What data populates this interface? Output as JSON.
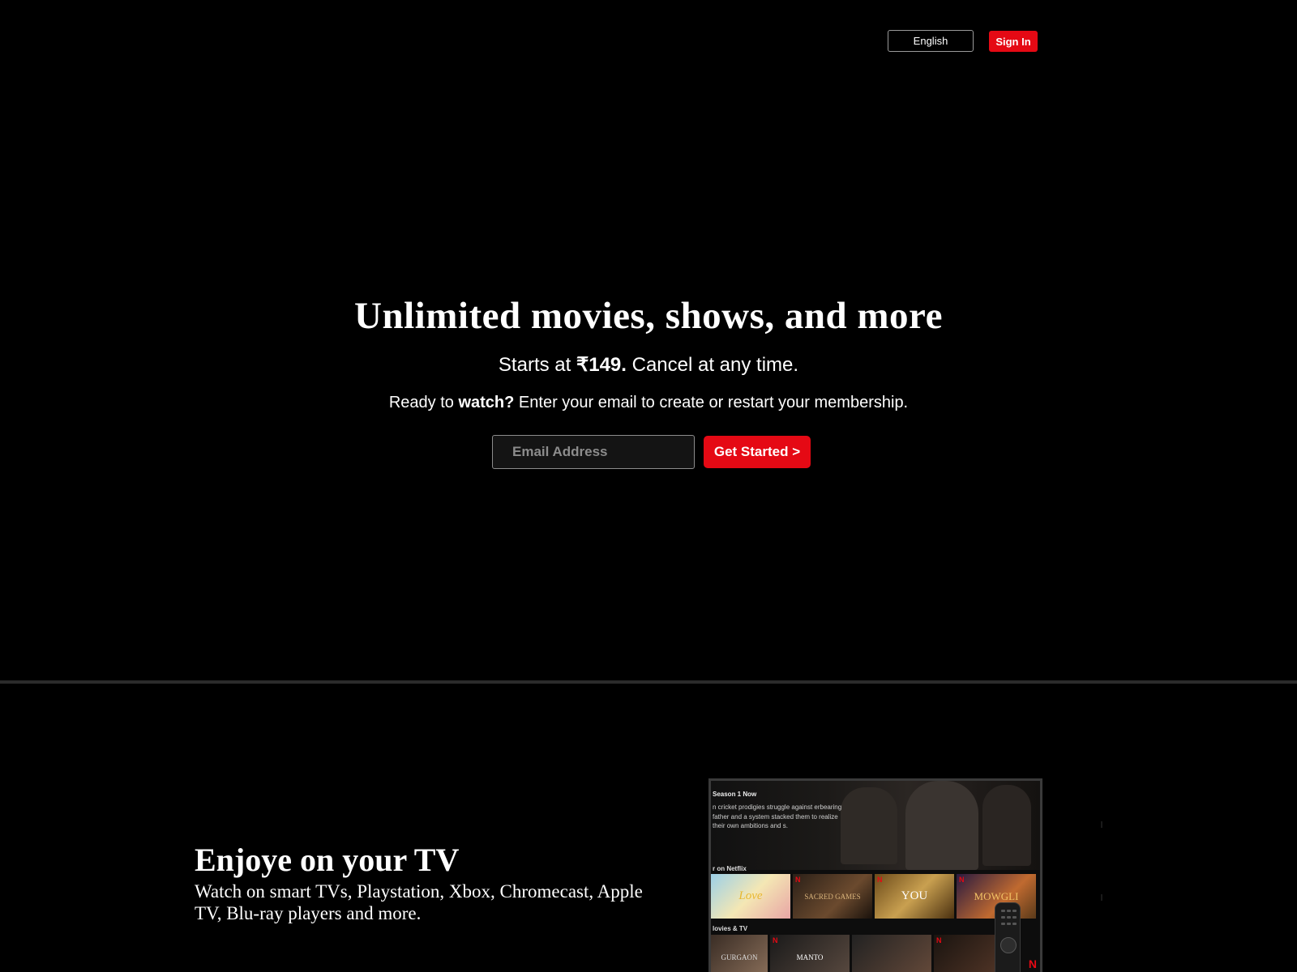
{
  "header": {
    "language_label": "English",
    "signin_label": "Sign In"
  },
  "hero": {
    "title": "Unlimited movies, shows, and more",
    "price_prefix": "Starts at ",
    "price_amount": "₹149.",
    "price_suffix": " Cancel at any time.",
    "ready_prefix": "Ready to ",
    "ready_bold": "watch?",
    "ready_suffix": " Enter your email to create or restart your membership.",
    "email_placeholder": "Email Address",
    "cta_label": "Get Started >"
  },
  "tv_section": {
    "heading": "Enjoye on your TV",
    "description": "Watch on smart TVs, Playstation, Xbox, Chromecast, Apple TV, Blu-ray players and more.",
    "screen": {
      "top_text": "                    ",
      "season_label": "Season 1 Now",
      "show_description": "n cricket prodigies struggle against erbearing father and a system stacked them to realize their own ambitions and s.",
      "row1_label": "r on Netflix",
      "row1_posters": [
        "Love",
        "SACRED GAMES",
        "YOU",
        "MOWGLI"
      ],
      "row2_label": "lovies & TV",
      "row2_posters": [
        "GURGAON",
        "MANTO",
        "",
        ""
      ],
      "logo_letter": "N"
    }
  },
  "colors": {
    "background": "#000000",
    "brand_red": "#e50914",
    "divider": "#2b2b2b"
  }
}
